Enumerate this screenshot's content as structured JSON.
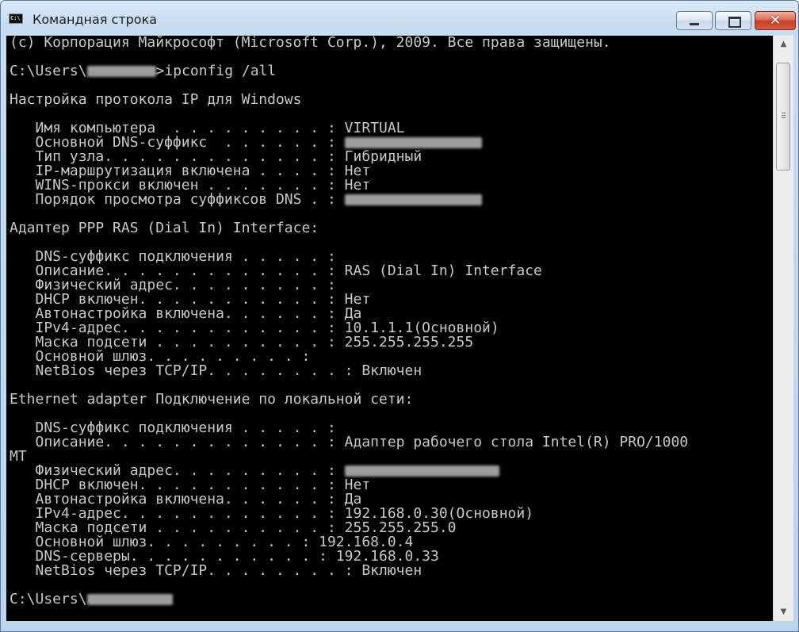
{
  "window": {
    "title": "Командная строка",
    "controls": {
      "minimize": "minimize",
      "maximize": "maximize",
      "close": "✕"
    }
  },
  "console": {
    "lines": [
      {
        "text": "(c) Корпорация Майкрософт (Microsoft Corp.), 2009. Все права защищены."
      },
      {
        "text": ""
      },
      {
        "text": "C:\\Users\\",
        "redact_chars": 8,
        "after": ">ipconfig /all"
      },
      {
        "text": ""
      },
      {
        "text": "Настройка протокола IP для Windows"
      },
      {
        "text": ""
      },
      {
        "text": "   Имя компьютера  . . . . . . . . . : VIRTUAL"
      },
      {
        "text": "   Основной DNS-суффикс  . . . . . . : ",
        "redact_chars": 16
      },
      {
        "text": "   Тип узла. . . . . . . . . . . . . : Гибридный"
      },
      {
        "text": "   IP-маршрутизация включена . . . . : Нет"
      },
      {
        "text": "   WINS-прокси включен . . . . . . . : Нет"
      },
      {
        "text": "   Порядок просмотра суффиксов DNS . : ",
        "redact_chars": 16
      },
      {
        "text": ""
      },
      {
        "text": "Адаптер PPP RAS (Dial In) Interface:"
      },
      {
        "text": ""
      },
      {
        "text": "   DNS-суффикс подключения . . . . . :"
      },
      {
        "text": "   Описание. . . . . . . . . . . . . : RAS (Dial In) Interface"
      },
      {
        "text": "   Физический адрес. . . . . . . . . :"
      },
      {
        "text": "   DHCP включен. . . . . . . . . . . : Нет"
      },
      {
        "text": "   Автонастройка включена. . . . . . : Да"
      },
      {
        "text": "   IPv4-адрес. . . . . . . . . . . . : 10.1.1.1(Основной)"
      },
      {
        "text": "   Маска подсети . . . . . . . . . . : 255.255.255.255"
      },
      {
        "text": "   Основной шлюз. . . . . . . . . :"
      },
      {
        "text": "   NetBios через TCP/IP. . . . . . . . : Включен"
      },
      {
        "text": ""
      },
      {
        "text": "Ethernet adapter Подключение по локальной сети:"
      },
      {
        "text": ""
      },
      {
        "text": "   DNS-суффикс подключения . . . . . :"
      },
      {
        "text": "   Описание. . . . . . . . . . . . . : Адаптер рабочего стола Intel(R) PRO/1000"
      },
      {
        "text": "MT"
      },
      {
        "text": "   Физический адрес. . . . . . . . . : ",
        "redact_chars": 18
      },
      {
        "text": "   DHCP включен. . . . . . . . . . . : Нет"
      },
      {
        "text": "   Автонастройка включена. . . . . . : Да"
      },
      {
        "text": "   IPv4-адрес. . . . . . . . . . . . : 192.168.0.30(Основной)"
      },
      {
        "text": "   Маска подсети . . . . . . . . . . : 255.255.255.0"
      },
      {
        "text": "   Основной шлюз. . . . . . . . . : 192.168.0.4"
      },
      {
        "text": "   DNS-серверы. . . . . . . . . . . : 192.168.0.33"
      },
      {
        "text": "   NetBios через TCP/IP. . . . . . . . : Включен"
      },
      {
        "text": ""
      },
      {
        "text": "C:\\Users\\",
        "redact_chars": 10,
        "after": ""
      }
    ]
  },
  "scrollbar": {
    "up_arrow": "▲",
    "down_arrow": "▼"
  }
}
